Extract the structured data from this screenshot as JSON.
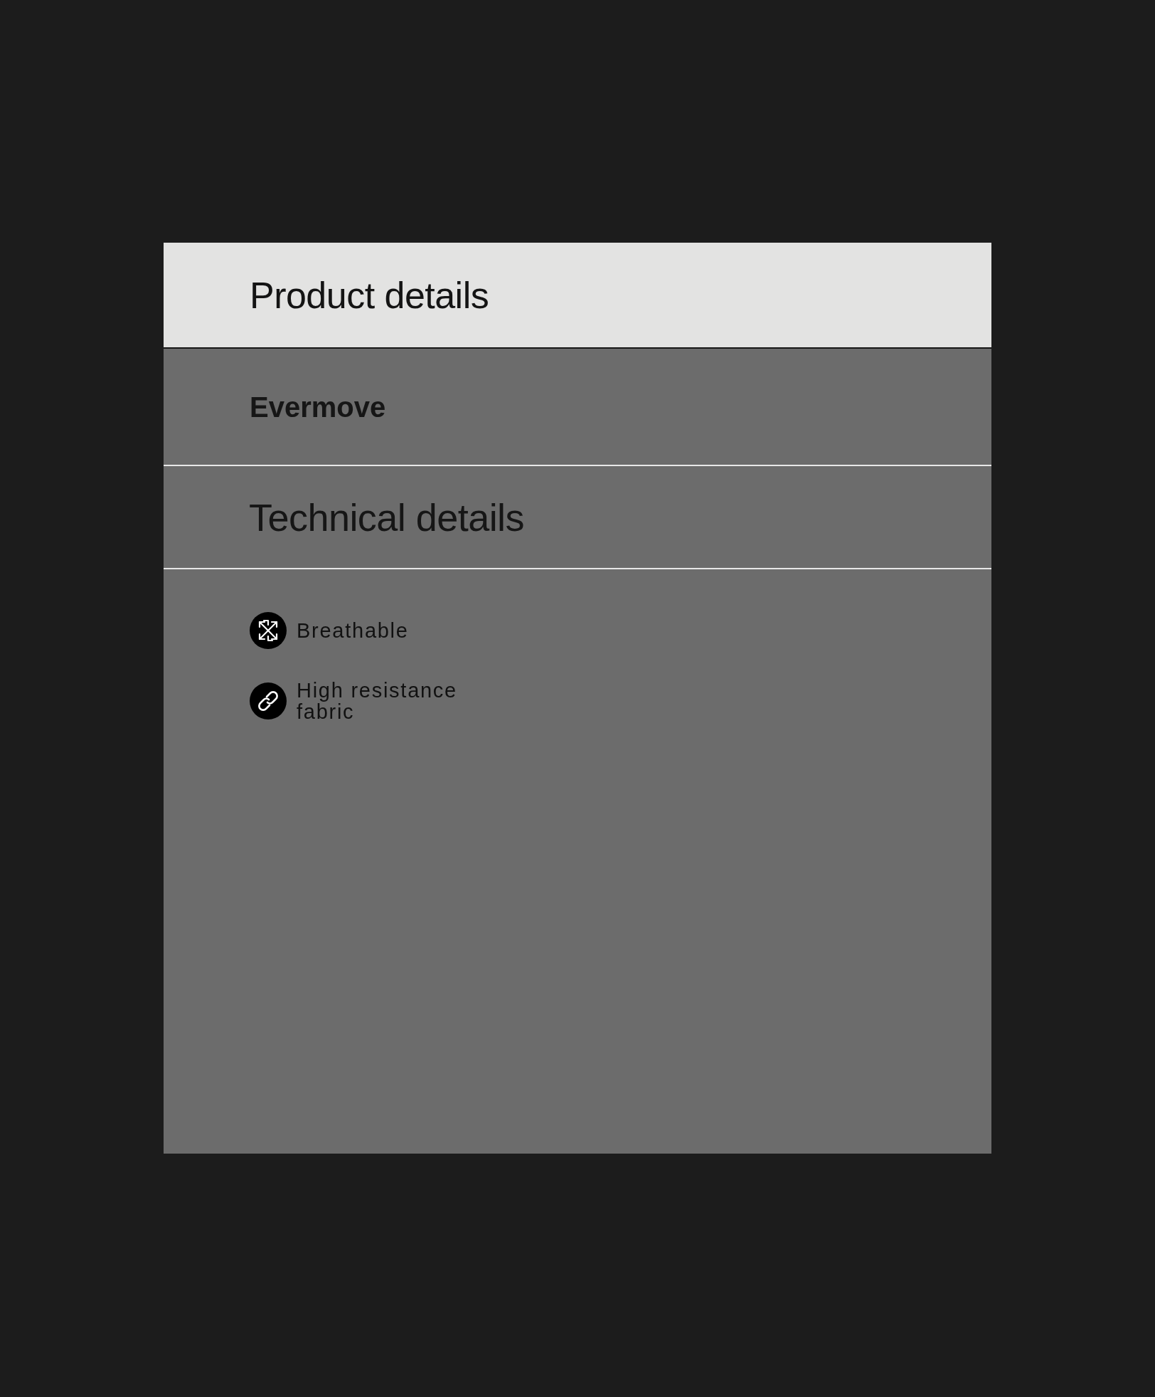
{
  "header": {
    "title": "Product details"
  },
  "product": {
    "name": "Evermove"
  },
  "technical_section": {
    "title": "Technical details"
  },
  "features": [
    {
      "kind": "breathable",
      "label": "Breathable"
    },
    {
      "kind": "resistance",
      "label": "High resistance fabric"
    }
  ]
}
